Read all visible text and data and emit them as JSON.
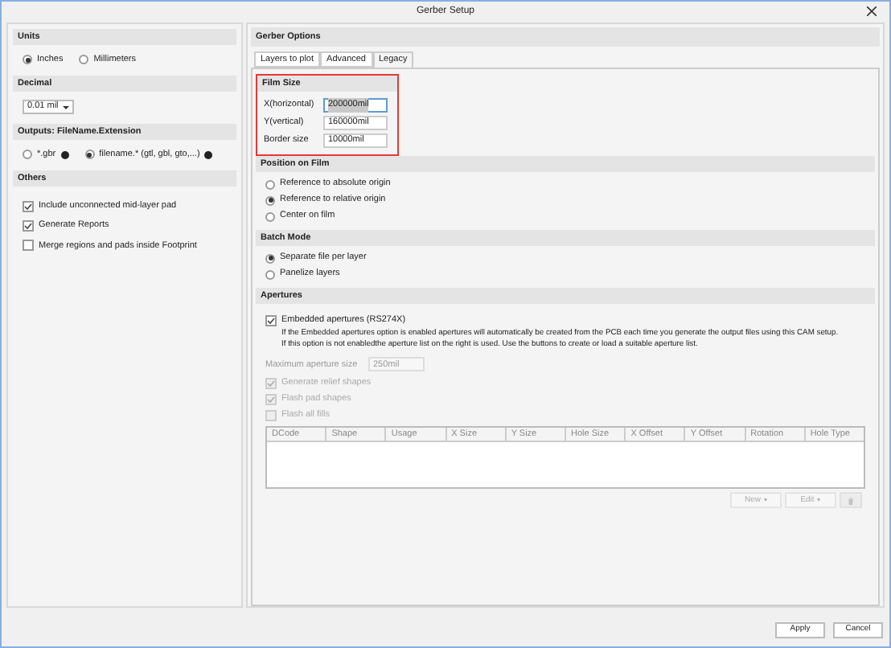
{
  "window": {
    "title": "Gerber Setup"
  },
  "left_sections": [
    {
      "title": "Units",
      "kind": "radios",
      "options": [
        {
          "label": "Inches",
          "selected": true
        },
        {
          "label": "Millimeters",
          "selected": false
        }
      ]
    },
    {
      "title": "Decimal",
      "kind": "dropdown",
      "value": "0.01 mil"
    },
    {
      "title": "Outputs: FileName.Extension",
      "kind": "radios",
      "options": [
        {
          "label": "*.gbr",
          "selected": false,
          "info": true
        },
        {
          "label": "filename.* (gtl, gbl, gto,...)",
          "selected": true,
          "info": true
        }
      ]
    },
    {
      "title": "Others",
      "kind": "checks",
      "options": [
        {
          "label": "Include unconnected mid-layer pad",
          "checked": true,
          "disabled": false
        },
        {
          "label": "Generate Reports",
          "checked": true,
          "disabled": false
        },
        {
          "label": "Merge regions and pads inside Footprint",
          "checked": false,
          "disabled": false
        }
      ]
    }
  ],
  "gerber_options": {
    "title": "Gerber Options",
    "tabs": [
      {
        "label": "Layers to plot",
        "selected": false
      },
      {
        "label": "Advanced",
        "selected": false
      },
      {
        "label": "Legacy",
        "selected": true
      }
    ],
    "sections": [
      {
        "title": "Film Size",
        "kind": "fields",
        "highlighted": true,
        "fields": [
          {
            "label": "X(horizontal)",
            "value": "200000mil",
            "selected": true
          },
          {
            "label": "Y(vertical)",
            "value": "160000mil",
            "selected": false
          },
          {
            "label": "Border size",
            "value": "10000mil",
            "selected": false
          }
        ]
      },
      {
        "title": "Position on Film",
        "kind": "radios",
        "highlighted": false,
        "options": [
          {
            "label": "Reference to absolute origin",
            "selected": false
          },
          {
            "label": "Reference to relative origin",
            "selected": true
          },
          {
            "label": "Center on film",
            "selected": false
          }
        ]
      },
      {
        "title": "Batch Mode",
        "kind": "radios",
        "highlighted": false,
        "options": [
          {
            "label": "Separate file per layer",
            "selected": true
          },
          {
            "label": "Panelize layers",
            "selected": false
          }
        ]
      },
      {
        "title": "Apertures",
        "kind": "apertures",
        "highlighted": false,
        "embedded": {
          "label": "Embedded apertures (RS274X)",
          "checked": true
        },
        "description": [
          "If the Embedded apertures option is enabled apertures will automatically be created from the PCB each time you generate the output files using this CAM setup.",
          "If this option is not enabledthe aperture list on the right is used. Use the buttons to create or load a suitable aperture list."
        ],
        "max_size": {
          "label": "Maximum aperture size",
          "value": "250mil",
          "disabled": true
        },
        "checks": [
          {
            "label": "Generate relief shapes",
            "checked": true,
            "disabled": true
          },
          {
            "label": "Flash pad shapes",
            "checked": true,
            "disabled": true
          },
          {
            "label": "Flash all fills",
            "checked": false,
            "disabled": true
          }
        ],
        "table": {
          "columns": [
            "DCode",
            "Shape",
            "Usage",
            "X Size",
            "Y Size",
            "Hole Size",
            "X Offset",
            "Y Offset",
            "Rotation",
            "Hole Type"
          ]
        },
        "buttons": [
          {
            "kind": "menu",
            "label": "New",
            "disabled": true
          },
          {
            "kind": "menu",
            "label": "Edit",
            "disabled": true
          },
          {
            "kind": "trash",
            "disabled": true
          }
        ]
      }
    ]
  },
  "footer_buttons": [
    "Apply",
    "Cancel"
  ]
}
